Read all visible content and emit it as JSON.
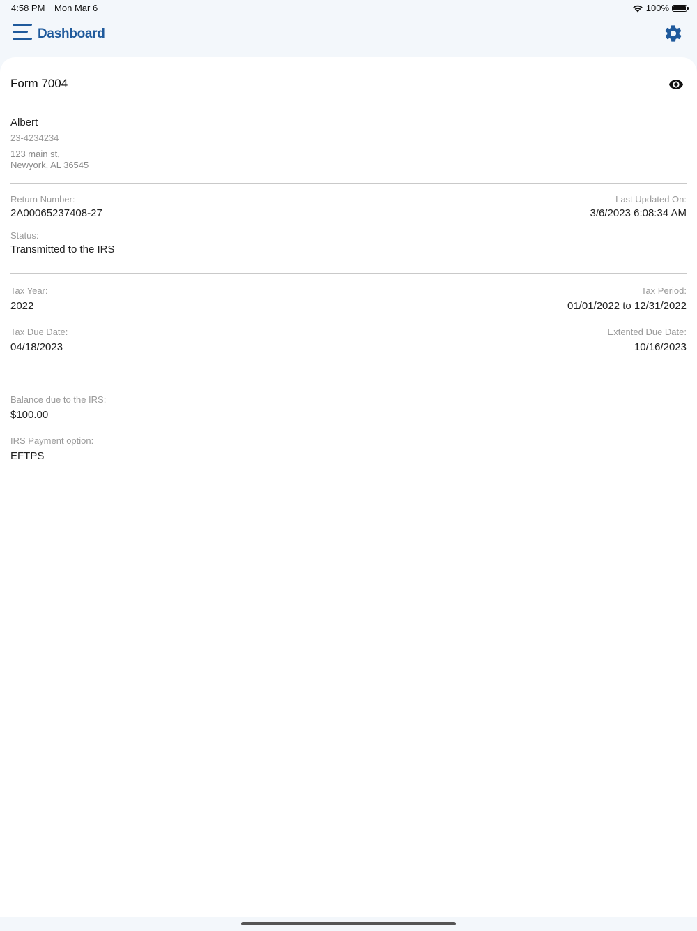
{
  "status_bar": {
    "time": "4:58 PM",
    "date": "Mon Mar 6",
    "battery": "100%",
    "icons": [
      "wifi-icon",
      "battery-icon"
    ]
  },
  "nav": {
    "title": "Dashboard",
    "menu_icon": "menu-icon",
    "settings_icon": "gear-icon",
    "accent_color": "#1f5a9c"
  },
  "form": {
    "title": "Form 7004",
    "preview_icon": "eye-icon",
    "business": {
      "name": "Albert",
      "ein": "23-4234234",
      "address_line1": "123 main st,",
      "address_line2": "Newyork, AL 36545"
    },
    "return_info": {
      "return_number_label": "Return Number:",
      "return_number": "2A00065237408-27",
      "last_updated_label": "Last Updated On:",
      "last_updated": "3/6/2023 6:08:34 AM",
      "status_label": "Status:",
      "status": "Transmitted to the IRS"
    },
    "tax_info": {
      "tax_year_label": "Tax Year:",
      "tax_year": "2022",
      "tax_period_label": "Tax Period:",
      "tax_period": "01/01/2022 to 12/31/2022",
      "tax_due_date_label": "Tax Due Date:",
      "tax_due_date": "04/18/2023",
      "extended_due_date_label": "Extented Due Date:",
      "extended_due_date": "10/16/2023"
    },
    "payment": {
      "balance_label": "Balance due to the IRS:",
      "balance": "$100.00",
      "payment_option_label": "IRS Payment option:",
      "payment_option": "EFTPS"
    }
  }
}
